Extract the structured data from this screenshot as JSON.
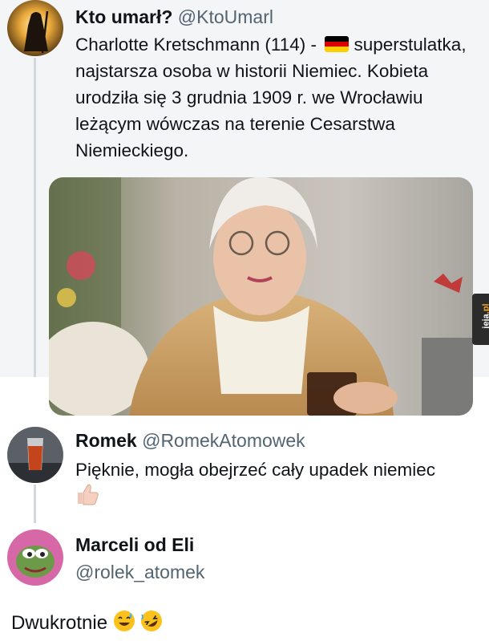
{
  "tweet1": {
    "display_name": "Kto umarł?",
    "handle": "@KtoUmarl",
    "text_before_flag": "Charlotte Kretschmann (114) -",
    "text_after_flag": "superstulatka, najstarsza osoba w historii Niemiec. Kobieta urodziła się 3 grudnia 1909 r. we Wrocławiu leżącym wówczas na terenie Cesarstwa Niemieckiego.",
    "flag_icon": "germany-flag-icon",
    "flag_colors": [
      "#000000",
      "#dd0000",
      "#ffce00"
    ],
    "avatar_icon": "hooded-figure-icon"
  },
  "reply1": {
    "display_name": "Romek",
    "handle": "@RomekAtomowek",
    "text": "Pięknie, mogła obejrzeć cały upadek niemiec",
    "emoji_icon": "thumbs-up-icon",
    "avatar_icon": "beer-glass-icon"
  },
  "reply2": {
    "display_name": "Marceli od Eli",
    "handle": "@rolek_atomek",
    "avatar_icon": "pepe-frog-icon"
  },
  "footer": {
    "text": "Dwukrotnie",
    "emojis": [
      "sweat-smile-icon",
      "rofl-icon"
    ]
  },
  "watermark": {
    "text_main": "jeja",
    "text_dot": ".pl"
  },
  "colors": {
    "thread_bg": "#f4f5f6",
    "handle": "#536471",
    "line": "#cfd9de"
  }
}
